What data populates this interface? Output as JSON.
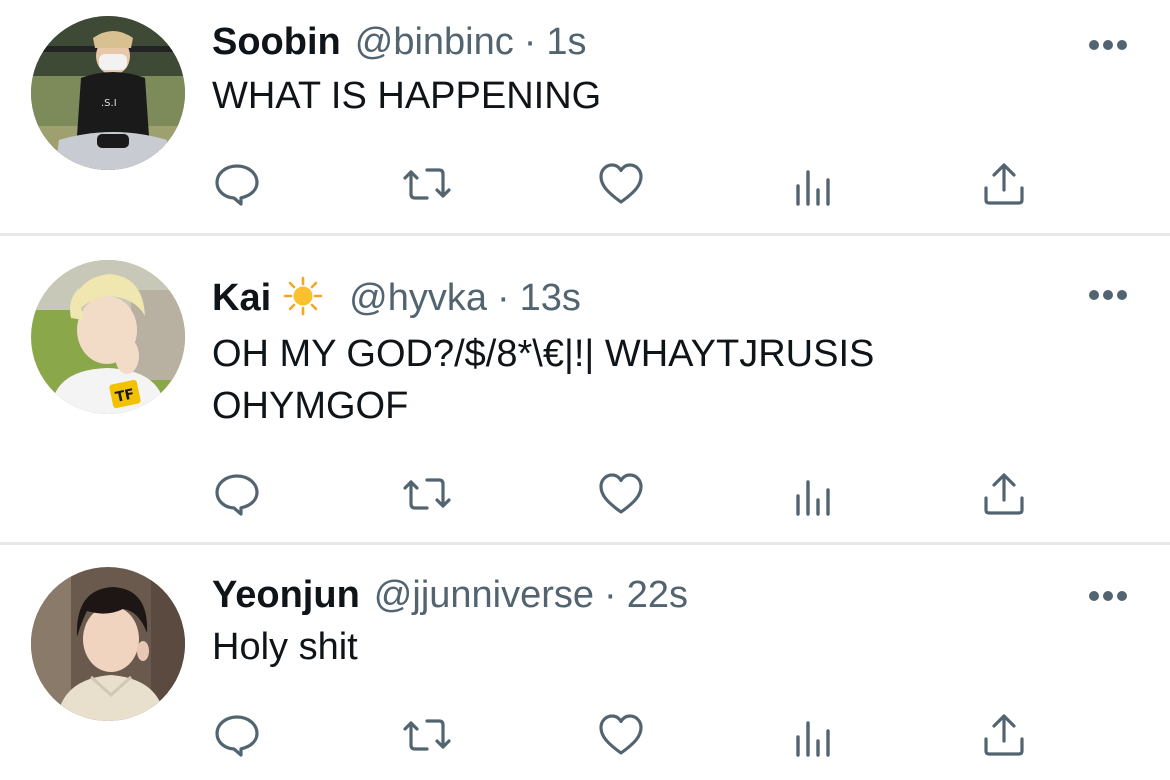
{
  "tweets": [
    {
      "name": "Soobin",
      "handle": "@binbinc",
      "separator": "·",
      "time": "1s",
      "text": "WHAT IS HAPPENING",
      "name_emoji": null
    },
    {
      "name": "Kai",
      "handle": "@hyvka",
      "separator": "·",
      "time": "13s",
      "text": "OH MY GOD?/$/8*\\€|!| WHAYTJRUSIS\nOHYMGOF",
      "name_emoji": "sun-emoji"
    },
    {
      "name": "Yeonjun",
      "handle": "@jjunniverse",
      "separator": "·",
      "time": "22s",
      "text": "Holy shit",
      "name_emoji": null
    }
  ],
  "actions": [
    "reply-icon",
    "retweet-icon",
    "like-icon",
    "analytics-icon",
    "share-icon"
  ],
  "more_icon": "more-horizontal-icon",
  "colors": {
    "icon": "#536471",
    "text": "#0f1419",
    "secondary": "#536471",
    "divider": "#e6e8ea",
    "background": "#ffffff"
  }
}
